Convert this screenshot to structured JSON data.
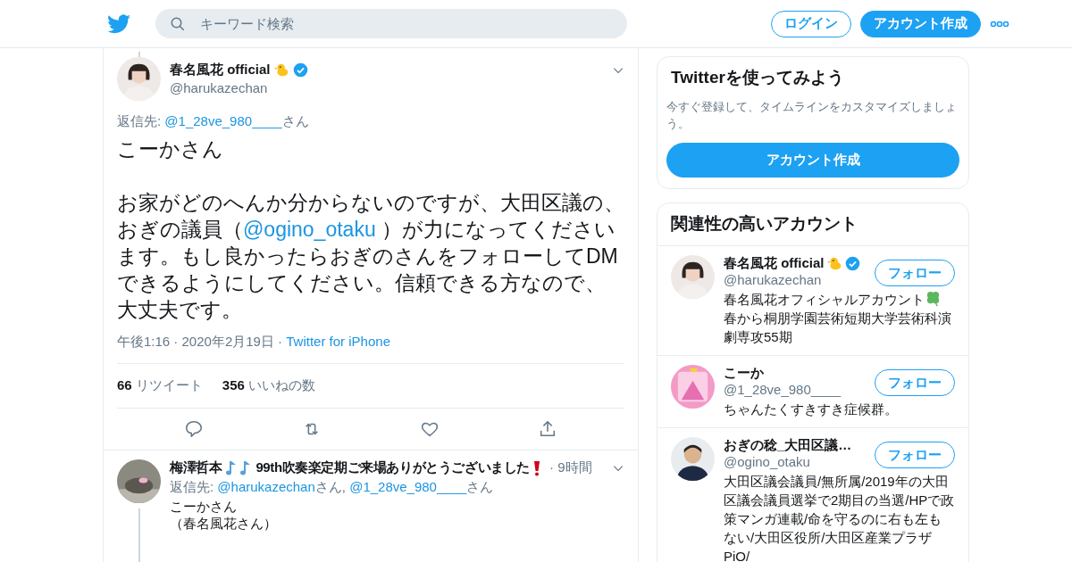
{
  "header": {
    "search": {
      "placeholder": "キーワード検索"
    },
    "login": "ログイン",
    "signup": "アカウント作成"
  },
  "tweet": {
    "name": "春名風花 official",
    "verified": true,
    "handle": "@harukazechan",
    "reply_label": "返信先: ",
    "reply_to": [
      {
        "handle": "@1_28ve_980____",
        "suffix": "さん"
      }
    ],
    "paragraphs": [
      [
        {
          "text": "こーかさん",
          "link": false
        }
      ],
      [
        {
          "text": "お家がどのへんか分からないのですが、大田区議の、おぎの議員（",
          "link": false
        },
        {
          "text": "@ogino_otaku",
          "link": true
        },
        {
          "text": " ）が力になってくださいます。もし良かったらおぎのさんをフォローしてDMできるようにしてください。信頼できる方なので、大丈夫です。",
          "link": false
        }
      ]
    ],
    "time": "午後1:16 · 2020年2月19日 ·",
    "source": "Twitter for iPhone",
    "retweets": "66",
    "retweets_label": "リツイート",
    "likes": "356",
    "likes_label": "いいねの数"
  },
  "reply": {
    "name": "梅澤哲本",
    "name_rest": "99th吹奏楽定期ご来場ありがとうございました",
    "time": "· 9時間",
    "reply_label": "返信先: ",
    "reply_to": [
      {
        "handle": "@harukazechan",
        "suffix": "さん, "
      },
      {
        "handle": "@1_28ve_980____",
        "suffix": "さん"
      }
    ],
    "lines": [
      "こーかさん",
      "（春名風花さん）"
    ]
  },
  "signup_card": {
    "title": "Twitterを使ってみよう",
    "text": "今すぐ登録して、タイムラインをカスタマイズしましょう。",
    "button": "アカウント作成"
  },
  "related": {
    "title": "関連性の高いアカウント",
    "accounts": [
      {
        "name": "春名風花 official",
        "verified": true,
        "handle": "@harukazechan",
        "bio": [
          "春名風花オフィシャルアカウント",
          "春から桐朋学園芸術短期大学芸術科演劇専攻55期"
        ],
        "follow": "フォロー"
      },
      {
        "name": "こーか",
        "verified": false,
        "handle": "@1_28ve_980____",
        "bio": [
          "ちゃんたくすきすき症候群。"
        ],
        "follow": "フォロー"
      },
      {
        "name": "おぎの稔_大田区議…",
        "verified": false,
        "handle": "@ogino_otaku",
        "bio": [
          "大田区議会議員/無所属/2019年の大田区議会議員選挙で2期目の当選/HPで政策マンガ連載/命を守るのに右も左もない/大田区役所/大田区産業プラザPiO/"
        ],
        "follow": "フォロー"
      }
    ]
  }
}
